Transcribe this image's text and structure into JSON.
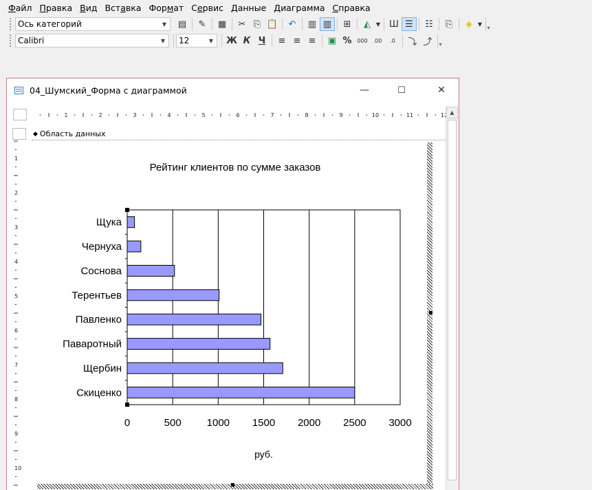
{
  "menu": [
    {
      "pre": "",
      "ul": "Ф",
      "post": "айл"
    },
    {
      "pre": "",
      "ul": "П",
      "post": "равка"
    },
    {
      "pre": "",
      "ul": "В",
      "post": "ид"
    },
    {
      "pre": "Вст",
      "ul": "а",
      "post": "вка"
    },
    {
      "pre": "Фор",
      "ul": "м",
      "post": "ат"
    },
    {
      "pre": "С",
      "ul": "е",
      "post": "рвис"
    },
    {
      "pre": "",
      "ul": "Д",
      "post": "анные"
    },
    {
      "pre": "",
      "ul": "Д",
      "post": "иаграмма"
    },
    {
      "pre": "",
      "ul": "С",
      "post": "правка"
    }
  ],
  "toolbar1": {
    "object_combo": "Ось категорий"
  },
  "toolbar2": {
    "font_combo": "Calibri",
    "size_combo": "12",
    "bold": "Ж",
    "italic": "К",
    "underline": "Ч",
    "percent": "%",
    "thousands": "000"
  },
  "window": {
    "title": "04_Шумский_Форма с диаграммой",
    "minimize": "—",
    "maximize": "☐",
    "close": "✕"
  },
  "section": {
    "label": "Область данных",
    "arrow": "◆"
  },
  "ruler_h": [
    "1",
    "2",
    "3",
    "4",
    "5",
    "6",
    "7",
    "8",
    "9",
    "10",
    "11",
    "12"
  ],
  "ruler_v": [
    "1",
    "2",
    "3",
    "4",
    "5",
    "6",
    "7",
    "8",
    "9",
    "10"
  ],
  "chart_data": {
    "type": "bar",
    "orientation": "horizontal",
    "title": "Рейтинг клиентов по сумме заказов",
    "xlabel": "руб.",
    "ylabel": "",
    "categories": [
      "Скиценко",
      "Щербин",
      "Паваротный",
      "Павленко",
      "Терентьев",
      "Соснова",
      "Чернуха",
      "Щука"
    ],
    "values": [
      2500,
      1710,
      1570,
      1470,
      1010,
      520,
      150,
      80
    ],
    "xlim": [
      0,
      3000
    ],
    "xticks": [
      0,
      500,
      1000,
      1500,
      2000,
      2500,
      3000
    ],
    "grid": "vertical",
    "bar_color": "#9999ff",
    "legend": "none"
  }
}
